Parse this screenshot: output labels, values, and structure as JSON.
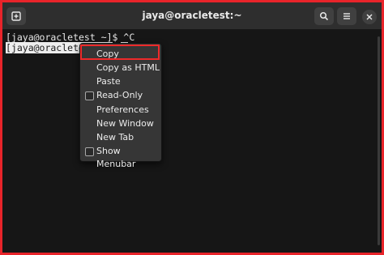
{
  "window": {
    "title": "jaya@oracletest:~"
  },
  "terminal": {
    "line1": "[jaya@oracletest ~]$ ^C",
    "line2_selected": "[jaya@oracletest ~]",
    "line2_rest": "$"
  },
  "context_menu": {
    "items": [
      {
        "label": "Copy",
        "checkbox": false
      },
      {
        "label": "Copy as HTML",
        "checkbox": false
      },
      {
        "label": "Paste",
        "checkbox": false
      },
      {
        "label": "Read-Only",
        "checkbox": true
      },
      {
        "label": "Preferences",
        "checkbox": false
      },
      {
        "label": "New Window",
        "checkbox": false
      },
      {
        "label": "New Tab",
        "checkbox": false
      },
      {
        "label": "Show Menubar",
        "checkbox": true
      }
    ]
  },
  "icons": [
    "new-tab-icon",
    "search-icon",
    "hamburger-menu-icon",
    "close-icon"
  ],
  "colors": {
    "highlight": "#ee2a2a",
    "background": "#161616",
    "titlebar": "#2e2e2e"
  }
}
